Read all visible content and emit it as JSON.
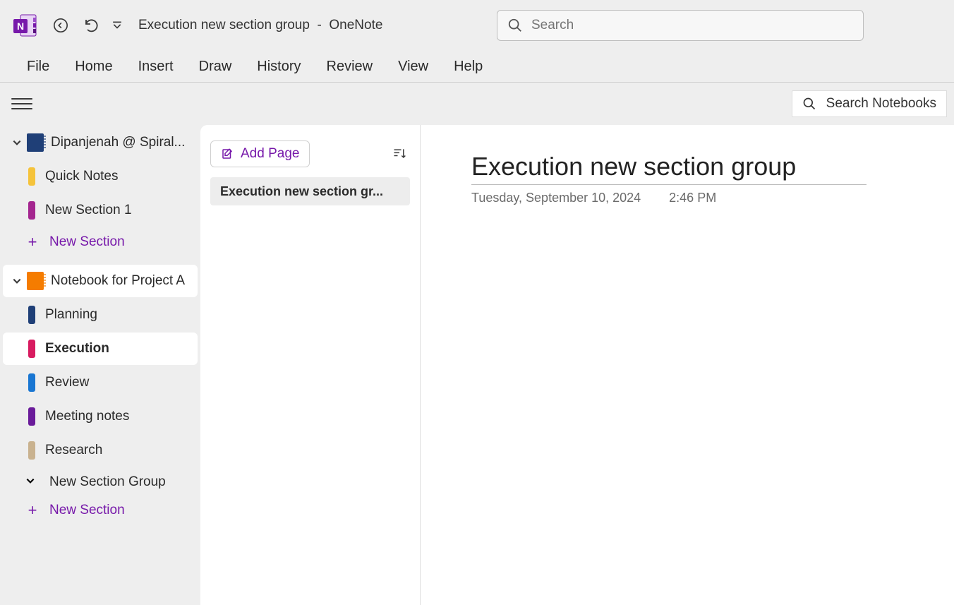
{
  "titlebar": {
    "document_title": "Execution new section group",
    "separator": "-",
    "app_name": "OneNote",
    "search_placeholder": "Search"
  },
  "ribbon": {
    "tabs": [
      "File",
      "Home",
      "Insert",
      "Draw",
      "History",
      "Review",
      "View",
      "Help"
    ]
  },
  "subbar": {
    "search_notebooks_label": "Search Notebooks"
  },
  "sidebar": {
    "notebooks": [
      {
        "name": "Dipanjenah @ Spiral...",
        "color": "#1f3f77",
        "expanded": true,
        "selected": false,
        "sections": [
          {
            "name": "Quick Notes",
            "color": "#f5c33b",
            "selected": false
          },
          {
            "name": "New Section 1",
            "color": "#a4268f",
            "selected": false
          }
        ],
        "add_section_label": "New Section"
      },
      {
        "name": "Notebook for Project A",
        "color": "#f57c00",
        "expanded": true,
        "selected": true,
        "sections": [
          {
            "name": "Planning",
            "color": "#1f3f77",
            "selected": false
          },
          {
            "name": "Execution",
            "color": "#d81b60",
            "selected": true
          },
          {
            "name": "Review",
            "color": "#1976d2",
            "selected": false
          },
          {
            "name": "Meeting notes",
            "color": "#6a1b9a",
            "selected": false
          },
          {
            "name": "Research",
            "color": "#c9b28f",
            "selected": false
          }
        ],
        "section_groups": [
          {
            "name": "New Section Group"
          }
        ],
        "add_section_label": "New Section"
      }
    ]
  },
  "pagelist": {
    "add_page_label": "Add Page",
    "pages": [
      {
        "title": "Execution new section gr...",
        "selected": true
      }
    ]
  },
  "canvas": {
    "title": "Execution new section group",
    "date": "Tuesday, September 10, 2024",
    "time": "2:46 PM"
  }
}
